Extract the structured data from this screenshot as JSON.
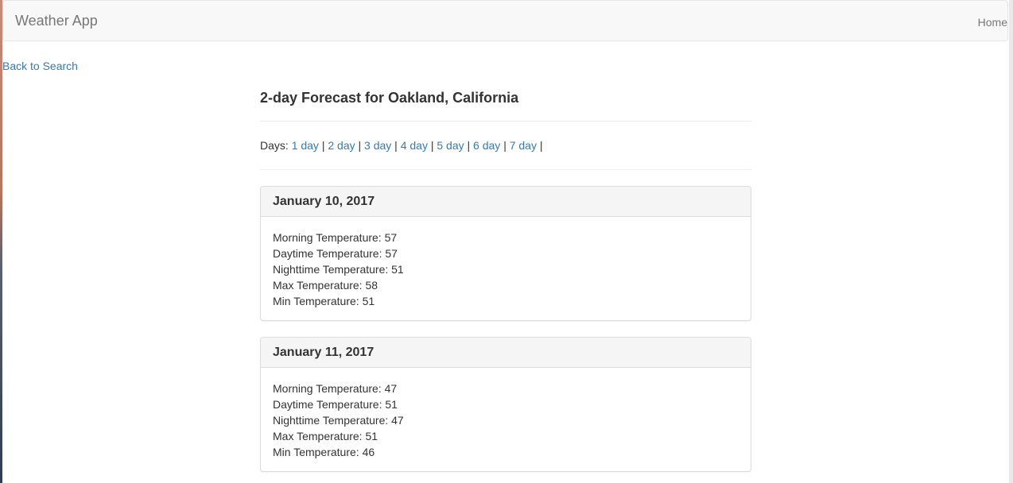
{
  "navbar": {
    "brand": "Weather App",
    "home": "Home"
  },
  "back_link": "Back to Search",
  "page_title": "2-day Forecast for Oakland, California",
  "days": {
    "label": "Days:",
    "separator": "|",
    "options": [
      "1 day",
      "2 day",
      "3 day",
      "4 day",
      "5 day",
      "6 day",
      "7 day"
    ]
  },
  "forecasts": [
    {
      "date": "January 10, 2017",
      "rows": [
        {
          "label": "Morning Temperature:",
          "value": "57"
        },
        {
          "label": "Daytime Temperature:",
          "value": "57"
        },
        {
          "label": "Nighttime Temperature:",
          "value": "51"
        },
        {
          "label": "Max Temperature:",
          "value": "58"
        },
        {
          "label": "Min Temperature:",
          "value": "51"
        }
      ]
    },
    {
      "date": "January 11, 2017",
      "rows": [
        {
          "label": "Morning Temperature:",
          "value": "47"
        },
        {
          "label": "Daytime Temperature:",
          "value": "51"
        },
        {
          "label": "Nighttime Temperature:",
          "value": "47"
        },
        {
          "label": "Max Temperature:",
          "value": "51"
        },
        {
          "label": "Min Temperature:",
          "value": "46"
        }
      ]
    }
  ],
  "colors": {
    "link": "#337ab7",
    "navbar_bg": "#f8f8f8",
    "navbar_text": "#777777",
    "panel_heading_bg": "#f5f5f5",
    "text": "#333333"
  }
}
